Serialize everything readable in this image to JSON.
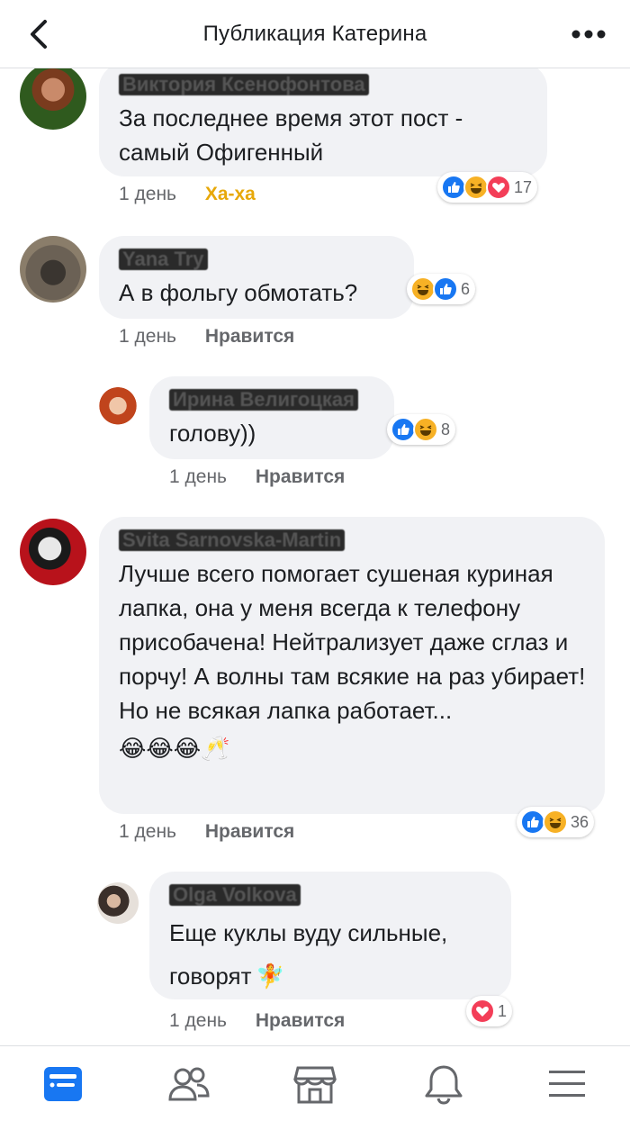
{
  "header": {
    "title": "Публикация Катерина",
    "back_icon": "back-chevron-icon",
    "more_icon": "more-dots-icon"
  },
  "comments": [
    {
      "author": "Виктория Ксенофонтова",
      "text": "За последнее время этот пост - самый Офигенный",
      "time": "1 день",
      "action": "Ха-ха",
      "reaction_icons": [
        "like-icon",
        "haha-icon",
        "love-icon"
      ],
      "reaction_count": "17"
    },
    {
      "author": "Yana Try",
      "text": "А в фольгу обмотать?",
      "time": "1 день",
      "action": "Нравится",
      "reaction_icons": [
        "haha-icon",
        "like-icon"
      ],
      "reaction_count": "6"
    },
    {
      "author": "Ирина Велигоцкая",
      "text": "голову))",
      "time": "1 день",
      "action": "Нравится",
      "reaction_icons": [
        "like-icon",
        "haha-icon"
      ],
      "reaction_count": "8"
    },
    {
      "author": "Svita Sarnovska-Martin",
      "text": "Лучше всего помогает сушеная куриная лапка, она у меня всегда к телефону присобачена! Нейтрализует даже сглаз и порчу! А волны там всякие на раз убирает! Но не всякая лапка работает...",
      "emoji": "😂😂😂🥂",
      "time": "1 день",
      "action": "Нравится",
      "reaction_icons": [
        "like-icon",
        "haha-icon"
      ],
      "reaction_count": "36"
    },
    {
      "author": "Olga Volkova",
      "text": "Еще куклы вуду сильные, говорят",
      "emoji": "🧚",
      "time": "1 день",
      "action": "Нравится",
      "reaction_icons": [
        "love-icon"
      ],
      "reaction_count": "1"
    }
  ],
  "tabs": [
    "news-feed-icon",
    "friends-icon",
    "marketplace-icon",
    "notifications-icon",
    "menu-icon"
  ],
  "colors": {
    "accent": "#1877f2",
    "haha": "#f7b125",
    "love": "#f33e58",
    "bubble": "#f1f2f5",
    "meta": "#65676b"
  }
}
